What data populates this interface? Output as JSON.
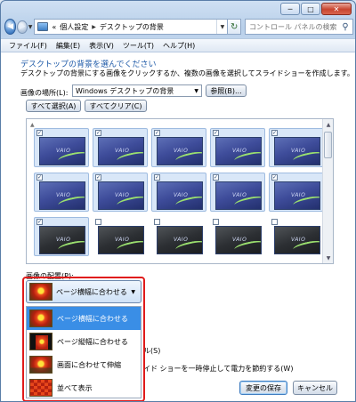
{
  "window": {
    "minimize": "─",
    "maximize": "□",
    "close": "✕"
  },
  "nav": {
    "back": "◀",
    "forward": "▶",
    "address": [
      "«",
      "個人設定",
      "デスクトップの背景"
    ],
    "refresh": "↻",
    "search_placeholder": "コントロール パネルの検索"
  },
  "menu": [
    "ファイル(F)",
    "編集(E)",
    "表示(V)",
    "ツール(T)",
    "ヘルプ(H)"
  ],
  "page": {
    "heading": "デスクトップの背景を選んでください",
    "description": "デスクトップの背景にする画像をクリックするか、複数の画像を選択してスライドショーを作成します。",
    "location_label": "画像の場所(L):",
    "location_value": "Windows デスクトップの背景",
    "browse_label": "参照(B)...",
    "select_all_label": "すべて選択(A)",
    "clear_all_label": "すべてクリア(C)"
  },
  "gallery": {
    "checked_mark": "✓",
    "logo_text": "VAIO",
    "items": [
      {
        "checked": true,
        "theme": "blue"
      },
      {
        "checked": true,
        "theme": "blue"
      },
      {
        "checked": true,
        "theme": "blue"
      },
      {
        "checked": true,
        "theme": "blue"
      },
      {
        "checked": true,
        "theme": "blue"
      },
      {
        "checked": true,
        "theme": "blue"
      },
      {
        "checked": true,
        "theme": "blue"
      },
      {
        "checked": true,
        "theme": "blue"
      },
      {
        "checked": true,
        "theme": "blue"
      },
      {
        "checked": true,
        "theme": "blue"
      },
      {
        "checked": true,
        "theme": "dark"
      },
      {
        "checked": false,
        "theme": "dark"
      },
      {
        "checked": false,
        "theme": "dark"
      },
      {
        "checked": false,
        "theme": "dark"
      },
      {
        "checked": false,
        "theme": "dark"
      }
    ]
  },
  "position": {
    "label": "画像の配置(P):",
    "selected": "ページ横幅に合わせる",
    "options": [
      {
        "label": "ページ横幅に合わせる",
        "icon": "fill"
      },
      {
        "label": "ページ縦幅に合わせる",
        "icon": "fit"
      },
      {
        "label": "画面に合わせて伸縮",
        "icon": "stretch"
      },
      {
        "label": "並べて表示",
        "icon": "tile"
      }
    ]
  },
  "fragments": {
    "shuffle_tail": "ル(S)",
    "battery_tail": "イド ショーを一時停止して電力を節約する(W)"
  },
  "footer": {
    "save_label": "変更の保存",
    "cancel_label": "キャンセル"
  }
}
